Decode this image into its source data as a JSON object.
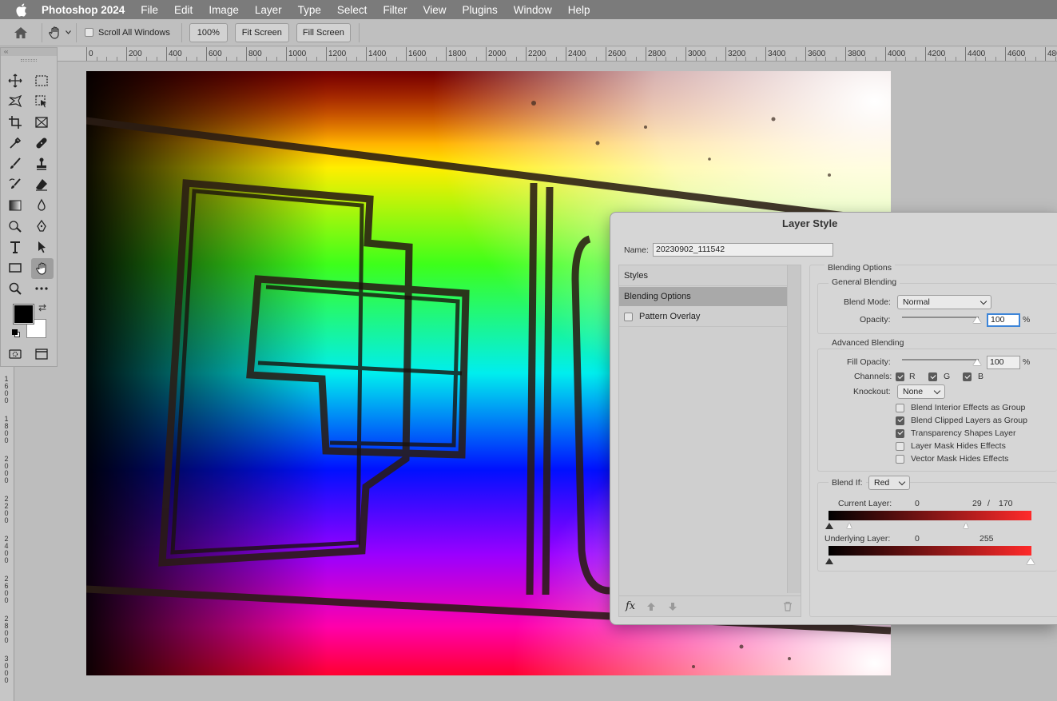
{
  "menubar": {
    "app": "Photoshop 2024",
    "items": [
      "File",
      "Edit",
      "Image",
      "Layer",
      "Type",
      "Select",
      "Filter",
      "View",
      "Plugins",
      "Window",
      "Help"
    ]
  },
  "options": {
    "scroll_all": "Scroll All Windows",
    "zoom_100": "100%",
    "fit_screen": "Fit Screen",
    "fill_screen": "Fill Screen"
  },
  "ruler": {
    "h_labels": [
      "0",
      "200",
      "400",
      "600",
      "800",
      "1000",
      "1200",
      "1400",
      "1600",
      "1800",
      "2000",
      "2200",
      "2400",
      "2600",
      "2800",
      "3000",
      "3200",
      "3400",
      "3600",
      "3800",
      "4000",
      "4200",
      "4400",
      "4600",
      "480"
    ],
    "v_labels": [
      "1600",
      "1800",
      "2000",
      "2200",
      "2400",
      "2600",
      "2800",
      "3000"
    ]
  },
  "tools": [
    "move-icon",
    "marquee-icon",
    "lasso-icon",
    "object-select-icon",
    "crop-icon",
    "frame-icon",
    "eyedropper-icon",
    "healing-icon",
    "brush-icon",
    "stamp-icon",
    "history-brush-icon",
    "eraser-icon",
    "gradient-icon",
    "blur-icon",
    "dodge-icon",
    "pen-icon",
    "type-icon",
    "path-select-icon",
    "rectangle-icon",
    "hand-icon",
    "zoom-icon",
    "more-icon",
    "quickmask-icon",
    "screenmode-icon"
  ],
  "dialog": {
    "title": "Layer Style",
    "name_label": "Name:",
    "name_value": "20230902_111542",
    "styles_header": "Styles",
    "style_items": [
      {
        "label": "Blending Options",
        "selected": true,
        "checkbox": false
      },
      {
        "label": "Pattern Overlay",
        "selected": false,
        "checkbox": true,
        "checked": false
      }
    ],
    "fx_label": "fx",
    "blending": {
      "section": "Blending Options",
      "general": "General Blending",
      "blend_mode_label": "Blend Mode:",
      "blend_mode": "Normal",
      "opacity_label": "Opacity:",
      "opacity": "100",
      "pct": "%",
      "advanced": "Advanced Blending",
      "fill_opacity_label": "Fill Opacity:",
      "fill_opacity": "100",
      "channels_label": "Channels:",
      "channels": [
        {
          "label": "R",
          "checked": true
        },
        {
          "label": "G",
          "checked": true
        },
        {
          "label": "B",
          "checked": true
        }
      ],
      "knockout_label": "Knockout:",
      "knockout": "None",
      "options": [
        {
          "label": "Blend Interior Effects as Group",
          "checked": false
        },
        {
          "label": "Blend Clipped Layers as Group",
          "checked": true
        },
        {
          "label": "Transparency Shapes Layer",
          "checked": true
        },
        {
          "label": "Layer Mask Hides Effects",
          "checked": false
        },
        {
          "label": "Vector Mask Hides Effects",
          "checked": false
        }
      ],
      "blend_if_label": "Blend If:",
      "blend_if": "Red",
      "current_layer_label": "Current Layer:",
      "current_low": "0",
      "current_high_a": "29",
      "current_slash": "/",
      "current_high_b": "170",
      "underlying_label": "Underlying Layer:",
      "underlying_low": "0",
      "underlying_high": "255"
    }
  }
}
